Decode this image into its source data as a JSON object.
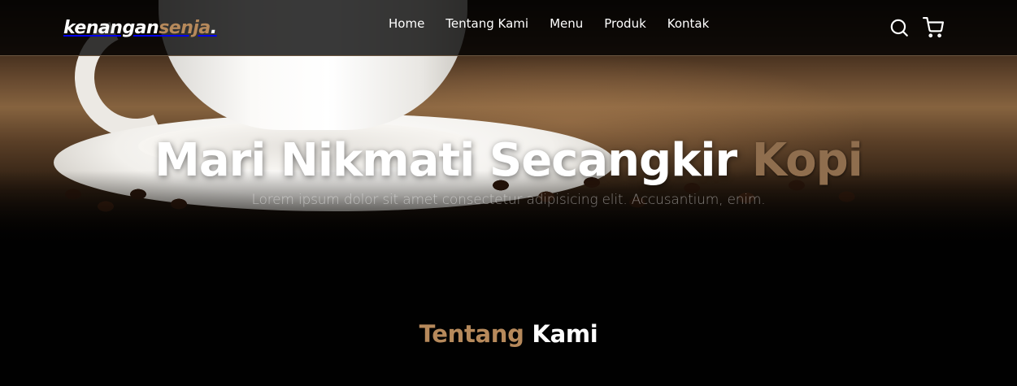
{
  "brand": {
    "part1": "kenangan",
    "part2": "senja",
    "dot": ".",
    "accent_color": "#b6895b"
  },
  "nav": {
    "items": [
      {
        "label": "Home"
      },
      {
        "label": "Tentang Kami"
      },
      {
        "label": "Menu"
      },
      {
        "label": "Produk"
      },
      {
        "label": "Kontak"
      }
    ],
    "icons": [
      "search-icon",
      "shopping-cart-icon"
    ]
  },
  "hero": {
    "title_main": "Mari Nikmati Secangkir",
    "title_accent": "Kopi",
    "subtitle": "Lorem ipsum dolor sit amet consectetur adipisicing elit. Accusantium, enim."
  },
  "about": {
    "title_accent": "Tentang",
    "title_rest": "Kami"
  }
}
